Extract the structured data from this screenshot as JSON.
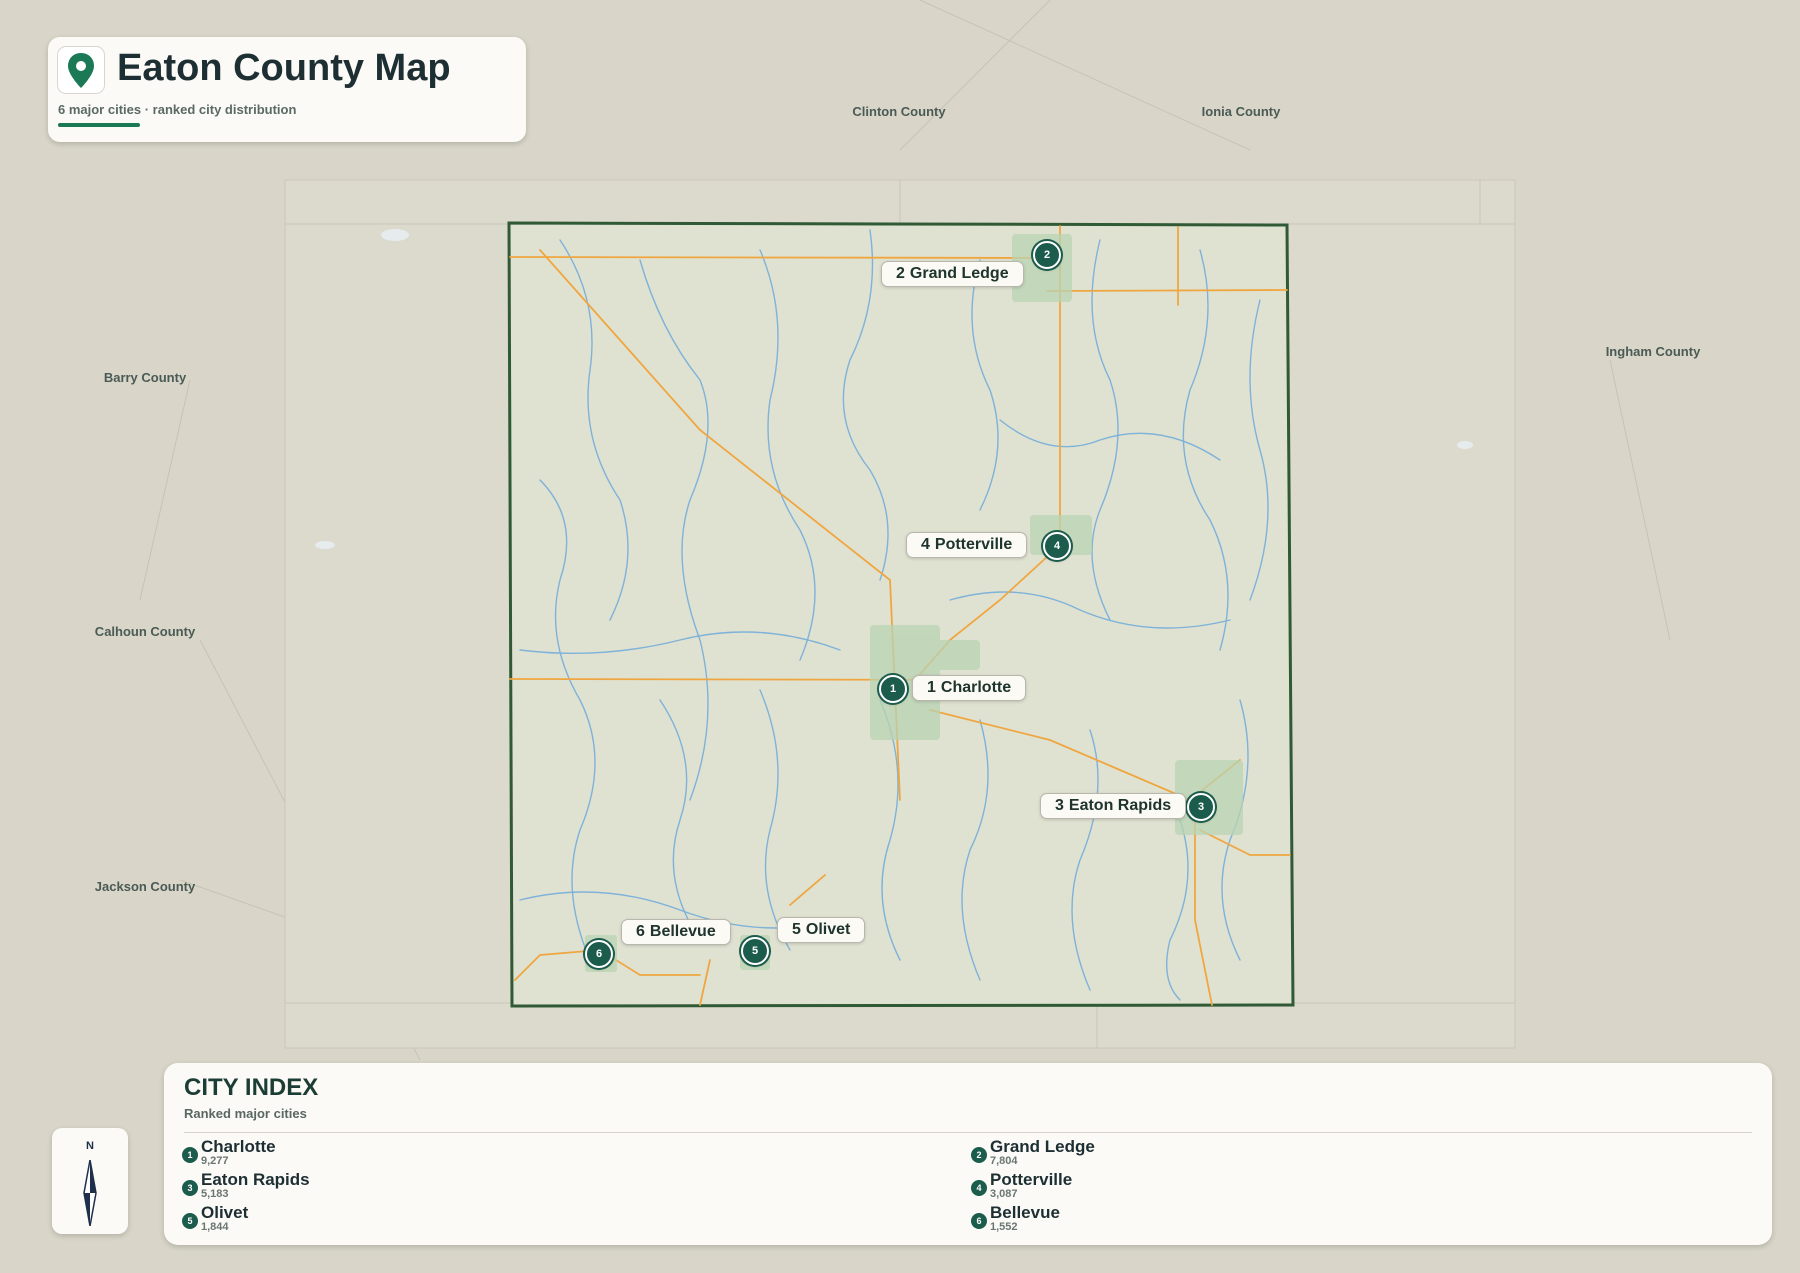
{
  "title": {
    "heading": "Eaton County Map",
    "subtitle": "6 major cities · ranked city distribution"
  },
  "neighbors": [
    {
      "id": "clinton",
      "label": "Clinton County"
    },
    {
      "id": "ionia",
      "label": "Ionia County"
    },
    {
      "id": "ingham",
      "label": "Ingham County"
    },
    {
      "id": "barry",
      "label": "Barry County"
    },
    {
      "id": "calhoun",
      "label": "Calhoun County"
    },
    {
      "id": "jackson",
      "label": "Jackson County"
    }
  ],
  "cities": [
    {
      "rank": "1",
      "name": "Charlotte",
      "population": "9,277"
    },
    {
      "rank": "2",
      "name": "Grand Ledge",
      "population": "7,804"
    },
    {
      "rank": "3",
      "name": "Eaton Rapids",
      "population": "5,183"
    },
    {
      "rank": "4",
      "name": "Potterville",
      "population": "3,087"
    },
    {
      "rank": "5",
      "name": "Olivet",
      "population": "1,844"
    },
    {
      "rank": "6",
      "name": "Bellevue",
      "population": "1,552"
    }
  ],
  "city_index": {
    "heading": "CITY INDEX",
    "subtitle": "Ranked major cities"
  },
  "compass": {
    "north_label": "N"
  },
  "colors": {
    "accent": "#1b7a55",
    "marker": "#1c5c4c",
    "county_border": "#2f5a35",
    "rivers": "#7fb2d9",
    "roads": "#f0a640",
    "urban": "#b9d3b3"
  },
  "icons": {
    "title": "map-pin-icon",
    "compass": "north-arrow-icon"
  }
}
